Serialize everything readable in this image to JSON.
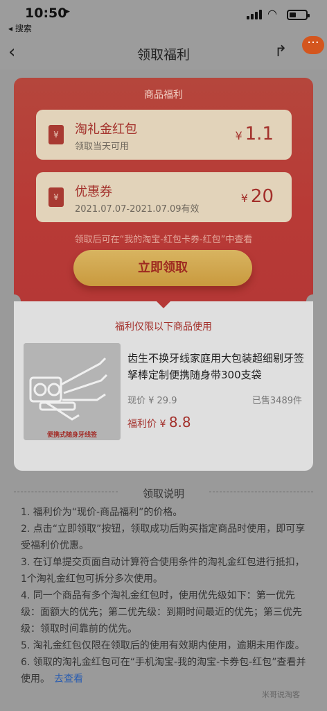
{
  "status": {
    "time": "10:50",
    "back_app": "◂ 搜索"
  },
  "nav": {
    "back": "‹",
    "title": "领取福利",
    "more": "···"
  },
  "benefits": {
    "section": "商品福利",
    "items": [
      {
        "name": "淘礼金红包",
        "sub": "领取当天可用",
        "currency": "¥",
        "amount": "1.1",
        "icon": "red-envelope-icon"
      },
      {
        "name": "优惠券",
        "sub": "2021.07.07-2021.07.09有效",
        "currency": "¥",
        "amount": "20",
        "icon": "ticket-icon"
      }
    ],
    "note": "领取后可在“我的淘宝-红包卡券-红包”中查看",
    "claim_label": "立即领取"
  },
  "product": {
    "section": "福利仅限以下商品使用",
    "name": "齿生不换牙线家庭用大包装超细剔牙签孥棒定制便携随身带300支袋",
    "price_now": "现价 ¥ 29.9",
    "sold": "已售3489件",
    "fuli_label": "福利价 ¥ ",
    "fuli_value": "8.8",
    "thumb_label": "便携式随身牙线签"
  },
  "instructions": {
    "title": "领取说明",
    "items": [
      "1. 福利价为“现价-商品福利”的价格。",
      "2. 点击“立即领取”按钮，领取成功后购买指定商品时使用，即可享受福利价优惠。",
      "3. 在订单提交页面自动计算符合使用条件的淘礼金红包进行抵扣，1个淘礼金红包可拆分多次使用。",
      "4. 同一个商品有多个淘礼金红包时，使用优先级如下：第一优先级：面额大的优先；第二优先级：到期时间最近的优先；第三优先级：领取时间靠前的优先。",
      "5. 淘礼金红包仅限在领取后的使用有效期内使用，逾期未用作废。",
      "6. 领取的淘礼金红包可在“手机淘宝-我的淘宝-卡券包-红包”查看并使用。"
    ],
    "link": "去查看"
  },
  "watermark": "米哥说淘客",
  "colors": {
    "accent": "#b53836",
    "gold": "#d8b461",
    "link": "#2a5db0"
  }
}
